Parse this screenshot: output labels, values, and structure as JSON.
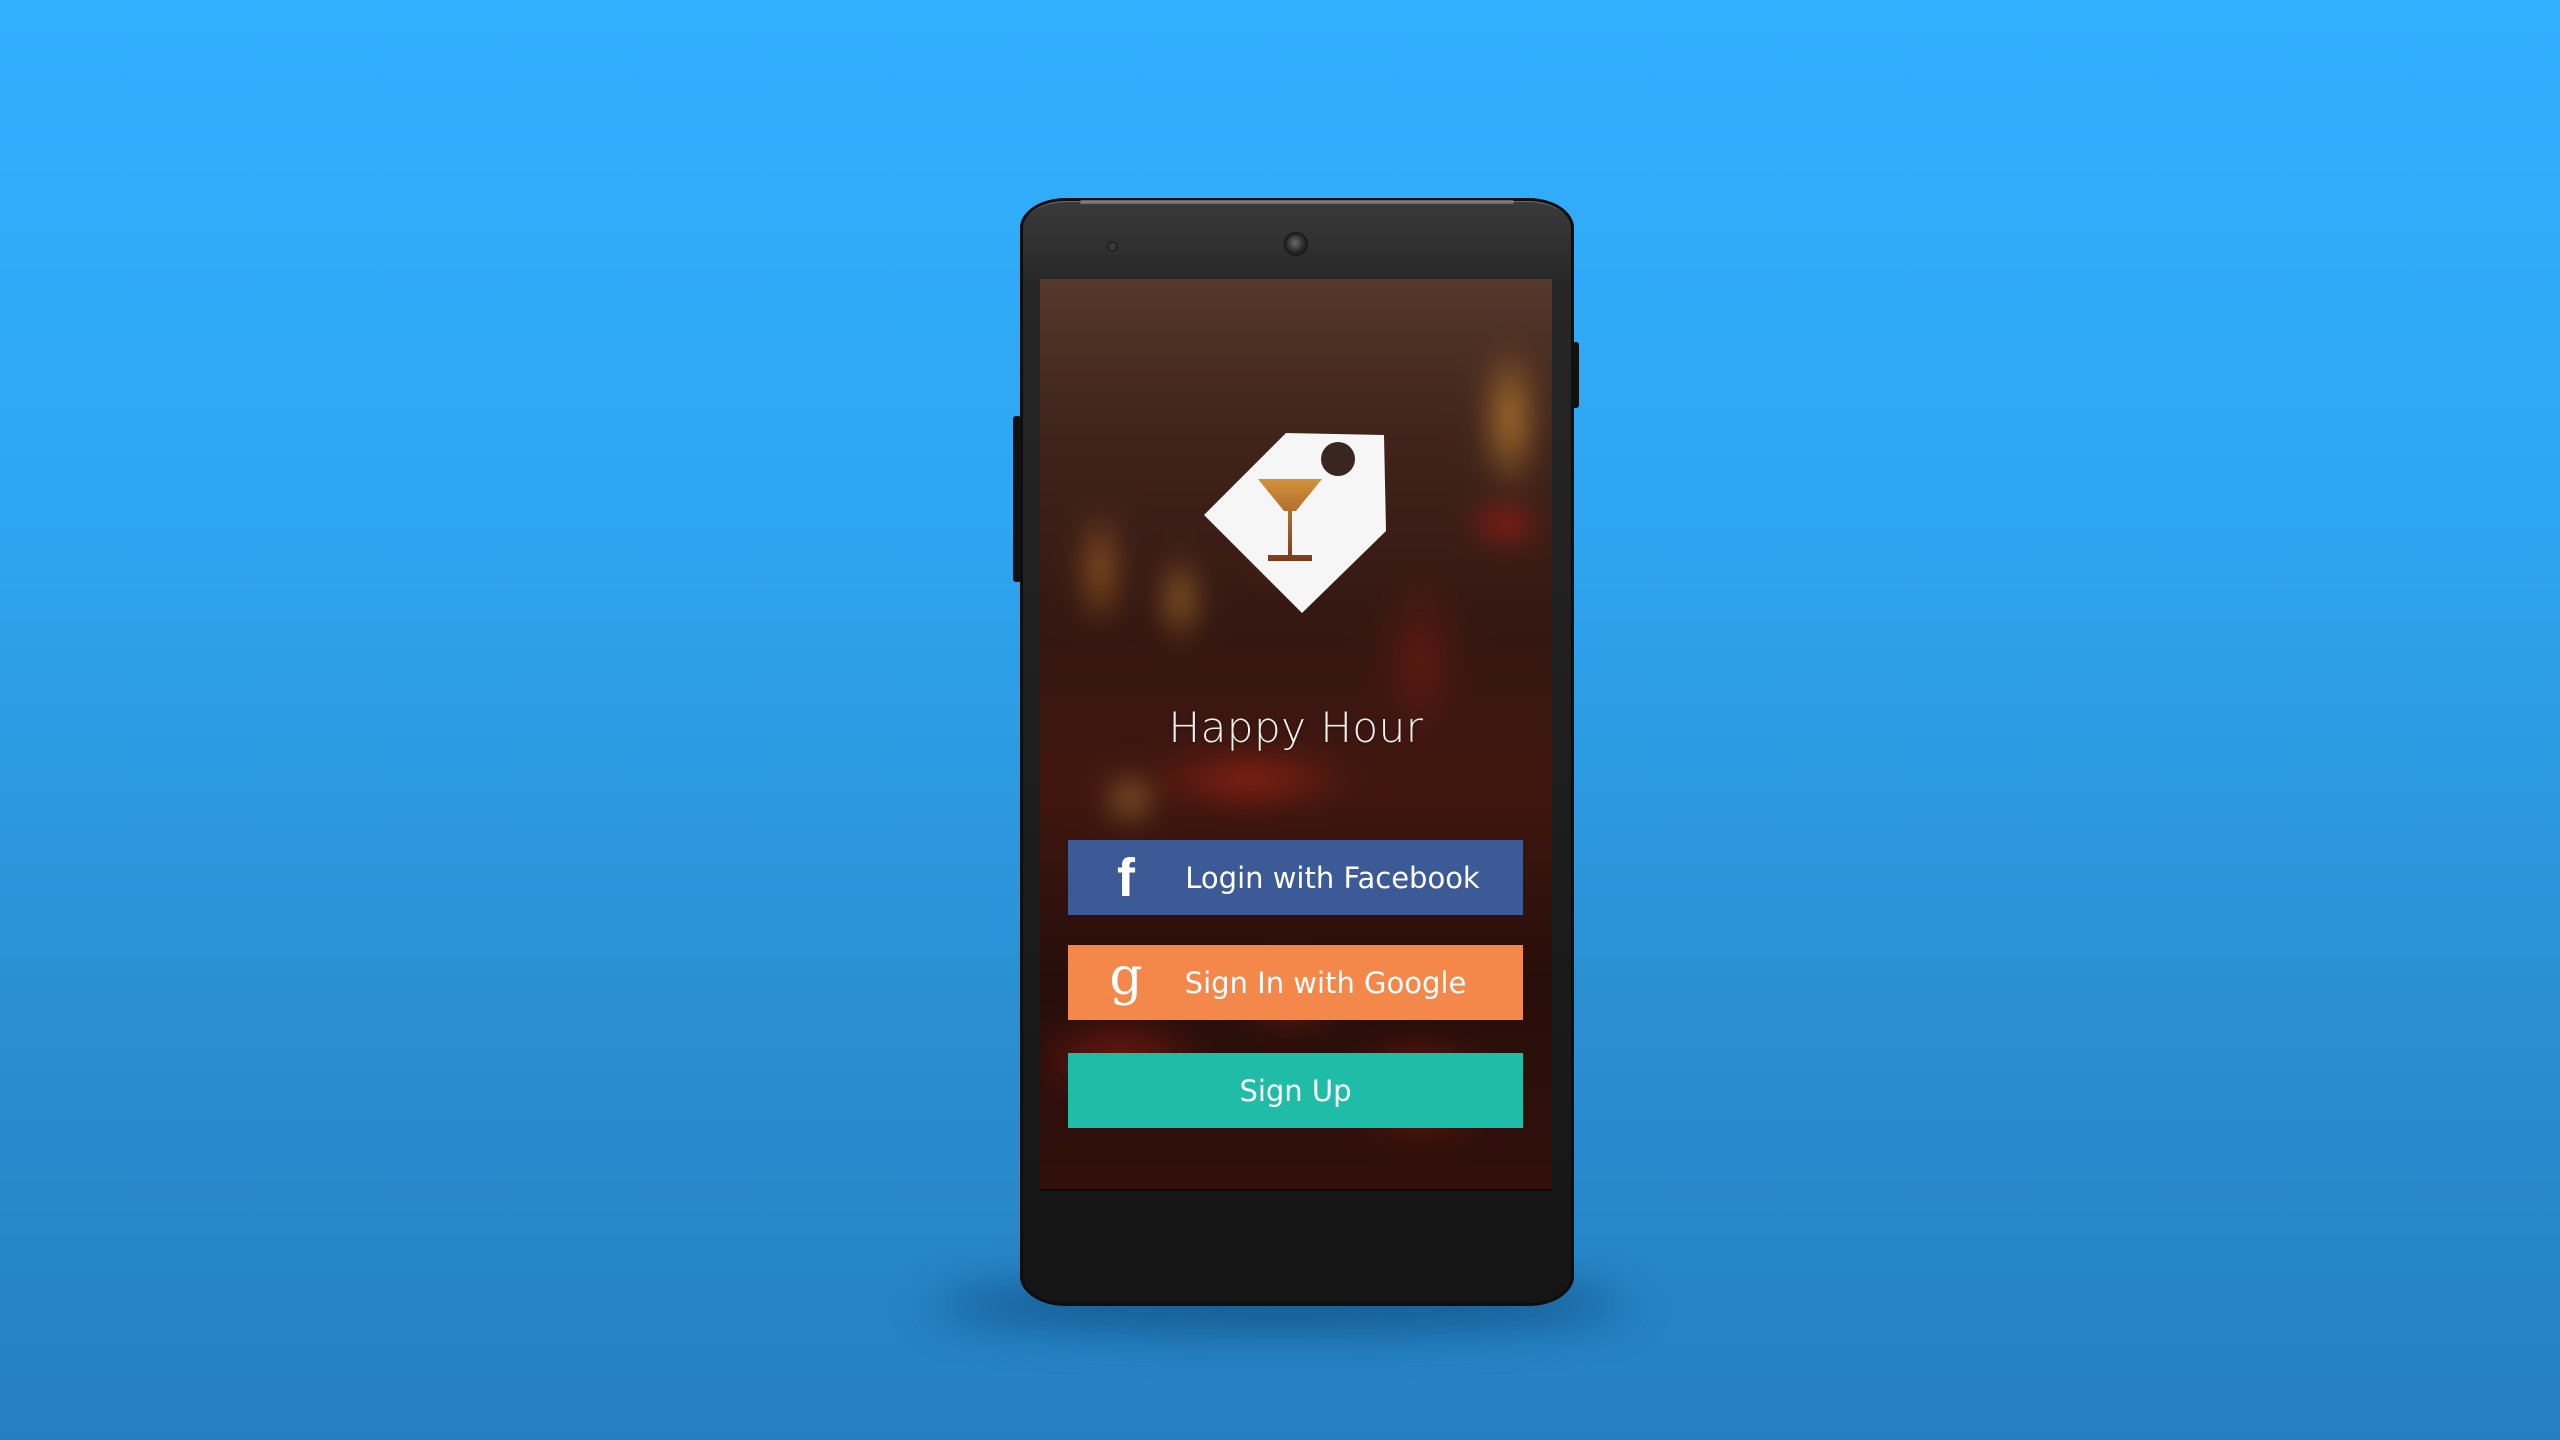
{
  "app": {
    "title": "Happy Hour",
    "logo_icon": "cocktail-tag-icon"
  },
  "buttons": {
    "facebook": {
      "label": "Login with Facebook",
      "icon": "f",
      "icon_name": "facebook-icon",
      "color": "#3c5a96"
    },
    "google": {
      "label": "Sign In with Google",
      "icon": "g",
      "icon_name": "google-icon",
      "color": "#f4874a"
    },
    "signup": {
      "label": "Sign Up",
      "color": "#1fbda8"
    }
  },
  "colors": {
    "background": "#31b0ff",
    "phone": "#1c1c1c"
  }
}
